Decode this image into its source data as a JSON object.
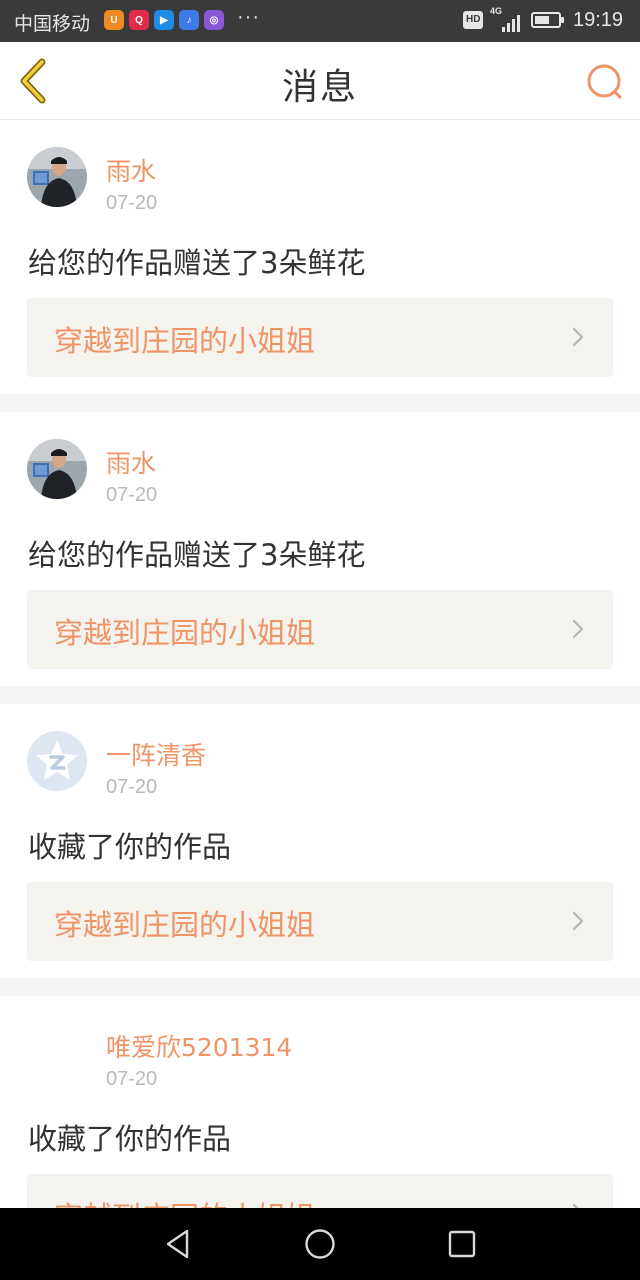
{
  "status_bar": {
    "carrier": "中国移动",
    "app_icons": [
      {
        "name": "uc-browser-icon",
        "color": "#f08a24",
        "glyph": "U"
      },
      {
        "name": "music-red-icon",
        "color": "#e62b4a",
        "glyph": "Q"
      },
      {
        "name": "youku-icon",
        "color": "#1e8ee8",
        "glyph": "▶"
      },
      {
        "name": "music-blue-icon",
        "color": "#3d7be6",
        "glyph": "♪"
      },
      {
        "name": "app-purple-icon",
        "color": "#8a58d6",
        "glyph": "◎"
      }
    ],
    "more": "···",
    "hd": "HD",
    "network": "4G",
    "time": "19:19",
    "battery_level": 0.6
  },
  "header": {
    "title": "消息",
    "accent_color": "#ee9467"
  },
  "messages": [
    {
      "name": "雨水",
      "date": "07-20",
      "action": "给您的作品赠送了3朵鲜花",
      "work_title": "穿越到庄园的小姐姐",
      "avatar": "photo"
    },
    {
      "name": "雨水",
      "date": "07-20",
      "action": "给您的作品赠送了3朵鲜花",
      "work_title": "穿越到庄园的小姐姐",
      "avatar": "photo"
    },
    {
      "name": "一阵清香",
      "date": "07-20",
      "action": "收藏了你的作品",
      "work_title": "穿越到庄园的小姐姐",
      "avatar": "qzone-default"
    },
    {
      "name": "唯爱欣5201314",
      "date": "07-20",
      "action": "收藏了你的作品",
      "work_title": "穿越到庄园的小姐姐",
      "avatar": "none"
    }
  ]
}
